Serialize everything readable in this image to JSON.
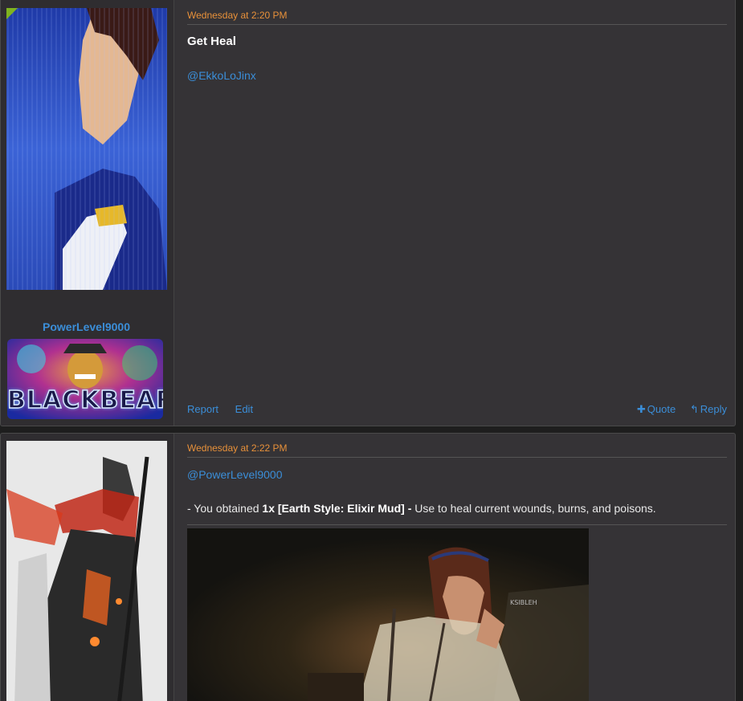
{
  "posts": [
    {
      "username": "PowerLevel9000",
      "banner_text": "BLACKBEARD",
      "date": "Wednesday at 2:20 PM",
      "title": "Get Heal",
      "mention": "@EkkoLoJinx",
      "footer": {
        "report": "Report",
        "edit": "Edit",
        "quote": "Quote",
        "reply": "Reply"
      }
    },
    {
      "date": "Wednesday at 2:22 PM",
      "mention": "@PowerLevel9000",
      "line": {
        "prefix": "- You obtained ",
        "qty": "1x",
        "item": "[Earth Style: Elixir Mud]",
        "dash": " -",
        "desc": " Use to heal current wounds, burns, and poisons."
      },
      "image_watermark": "KSIBLEH"
    }
  ],
  "colors": {
    "background": "#353336",
    "user_column": "#2f2d30",
    "date": "#e8913a",
    "link": "#3b8ed8",
    "online_marker": "#7fb31f"
  },
  "icons": {
    "quote": "plus-icon",
    "reply": "reply-arrow-icon"
  }
}
